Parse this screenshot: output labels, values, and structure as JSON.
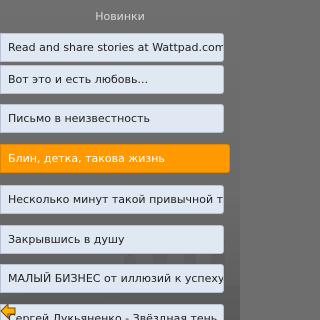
{
  "header": {
    "title": "Новинки"
  },
  "list": {
    "items": [
      {
        "label": "Read and share stories at Wattpad.com"
      },
      {
        "label": "Вот это и есть любовь..."
      },
      {
        "label": "Письмо в неизвестность"
      },
      {
        "label": "Блин, детка, такова жизнь"
      },
      {
        "label": "Несколько минут такой привычной тебе"
      },
      {
        "label": "Закрывшись в душу"
      },
      {
        "label": "МАЛЫЙ БИЗНЕС от иллюзий к успеху"
      },
      {
        "label": "Сергей Лукьяненко - Звёздная тень"
      }
    ],
    "selected_index": 3
  },
  "softkeys": {
    "back_icon": "back-arrow-icon"
  },
  "colors": {
    "background": "#6e6e6e",
    "item": "#dfe8f3",
    "selected": "#ff9900"
  }
}
